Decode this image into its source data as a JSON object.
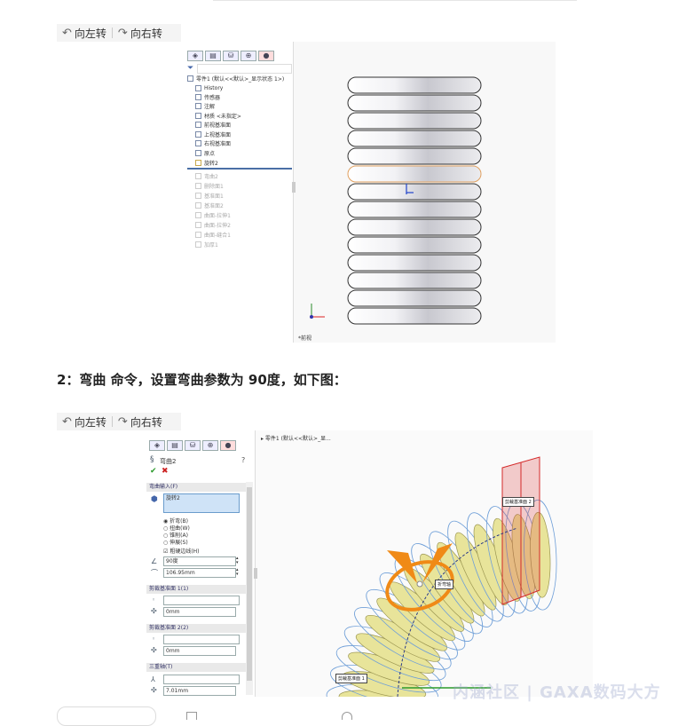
{
  "rotate_toolbar": {
    "left_label": "向左转",
    "right_label": "向右转"
  },
  "step2_heading": "2：弯曲 命令，设置弯曲参数为 90度，如下图：",
  "shot1": {
    "tree_root": "零件1 (默认<<默认>_显示状态 1>)",
    "items": [
      "History",
      "传感器",
      "注解",
      "材质 <未指定>",
      "前视基准面",
      "上视基准面",
      "右视基准面",
      "原点",
      "旋转2"
    ],
    "dim_items": [
      "弯曲2",
      "删除面1",
      "基准面1",
      "基准面2",
      "曲面-拉伸1",
      "曲面-拉伸2",
      "曲面-缝合1",
      "加厚1"
    ],
    "view_label": "*前视"
  },
  "shot2": {
    "breadcrumb": "零件1 (默认<<默认>_显...",
    "feature_name": "弯曲2",
    "section_input": "弯曲输入(F)",
    "selected_body": "旋转2",
    "options": [
      "折弯(B)",
      "扭曲(W)",
      "锥削(A)",
      "伸展(S)"
    ],
    "hard_edges": "粗硬边线(H)",
    "angle": "90度",
    "radius": "106.95mm",
    "section_plane1": "剪裁基准面 1(1)",
    "plane1_value": "0mm",
    "section_plane2": "剪裁基准面 2(2)",
    "plane2_value": "0mm",
    "section_triad": "三重轴(T)",
    "triad_value": "7.01mm",
    "label_plane2": "剪裁基准面 2",
    "label_plane1": "剪裁基准面 1",
    "label_fold_axis": "折弯轴"
  },
  "watermark": "内涵社区 | GAXA数码大方",
  "colors": {
    "spring_yellow": "#e8e49a",
    "blue_wire": "#6f9fd8",
    "red_plane": "#d42a2a",
    "orange_triad": "#f08a16"
  }
}
